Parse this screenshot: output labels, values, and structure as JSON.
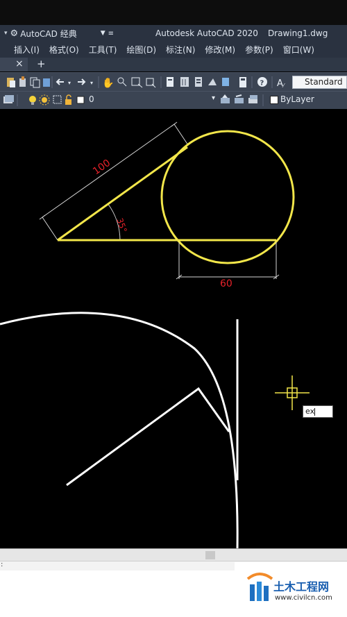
{
  "titlebar": {
    "workspace": "AutoCAD 经典",
    "app_title": "Autodesk AutoCAD 2020",
    "doc_title": "Drawing1.dwg"
  },
  "menu": {
    "items": [
      "插入(I)",
      "格式(O)",
      "工具(T)",
      "绘图(D)",
      "标注(N)",
      "修改(M)",
      "参数(P)",
      "窗口(W)"
    ]
  },
  "tabs": {
    "close": "×",
    "add": "+"
  },
  "toolbar": {
    "text_style": "Standard",
    "layer_value": "0",
    "color_value": "ByLayer"
  },
  "drawing": {
    "dim_length": "100",
    "dim_angle": "35°",
    "dim_width": "60",
    "colors": {
      "geometry": "#f2e64a",
      "dimension_text": "#e8222a",
      "dimension_line": "#d6d6d6",
      "arc": "#ffffff"
    }
  },
  "command": {
    "input": "ex"
  },
  "watermark": {
    "name": "土木工程网",
    "url": "www.civilcn.com"
  }
}
